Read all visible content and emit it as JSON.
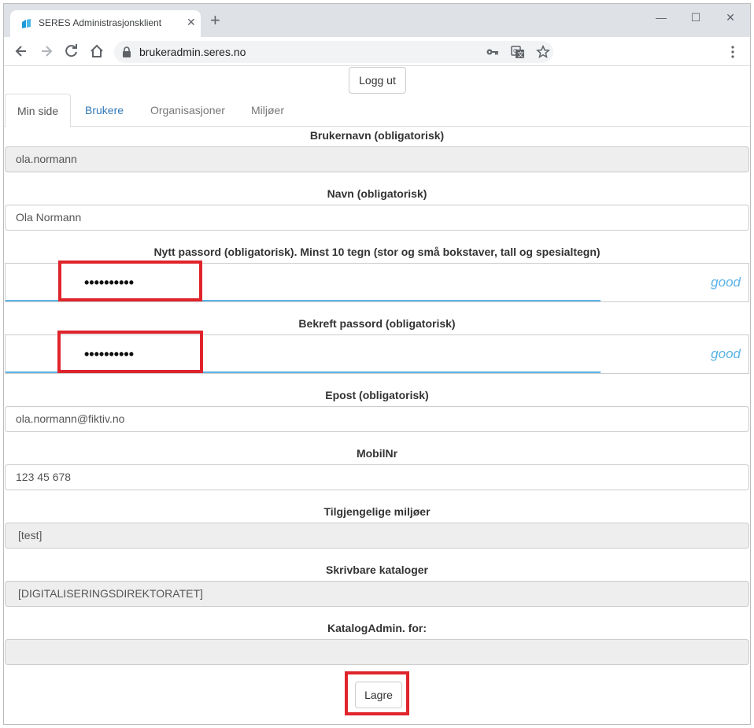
{
  "browser": {
    "tab_title": "SERES Administrasjonsklient",
    "url": "brukeradmin.seres.no",
    "icons": [
      "back-icon",
      "forward-icon",
      "reload-icon",
      "home-icon",
      "lock-icon",
      "key-icon",
      "translate-icon",
      "star-icon",
      "menu-icon"
    ]
  },
  "header": {
    "logout_label": "Logg ut"
  },
  "nav": {
    "tabs": [
      {
        "label": "Min side",
        "state": "active"
      },
      {
        "label": "Brukere",
        "state": "link"
      },
      {
        "label": "Organisasjoner",
        "state": "muted"
      },
      {
        "label": "Miljøer",
        "state": "muted"
      }
    ]
  },
  "form": {
    "username": {
      "label": "Brukernavn (obligatorisk)",
      "value": "ola.normann"
    },
    "name": {
      "label": "Navn (obligatorisk)",
      "value": "Ola Normann"
    },
    "new_password": {
      "label": "Nytt passord (obligatorisk). Minst 10 tegn (stor og små bokstaver, tall og spesialtegn)",
      "value": "••••••••••",
      "strength": "good"
    },
    "confirm_password": {
      "label": "Bekreft passord (obligatorisk)",
      "value": "••••••••••",
      "strength": "good"
    },
    "email": {
      "label": "Epost (obligatorisk)",
      "value": "ola.normann@fiktiv.no"
    },
    "mobile": {
      "label": "MobilNr",
      "value": "123 45 678"
    },
    "environments": {
      "label": "Tilgjengelige miljøer",
      "value": "[test]"
    },
    "catalogs": {
      "label": "Skrivbare kataloger",
      "value": "[DIGITALISERINGSDIREKTORATET]"
    },
    "catalog_admin": {
      "label": "KatalogAdmin. for:",
      "value": ""
    },
    "save_label": "Lagre"
  },
  "colors": {
    "highlight": "#e0242c",
    "strength": "#5cb3e6",
    "link": "#337ab7"
  }
}
